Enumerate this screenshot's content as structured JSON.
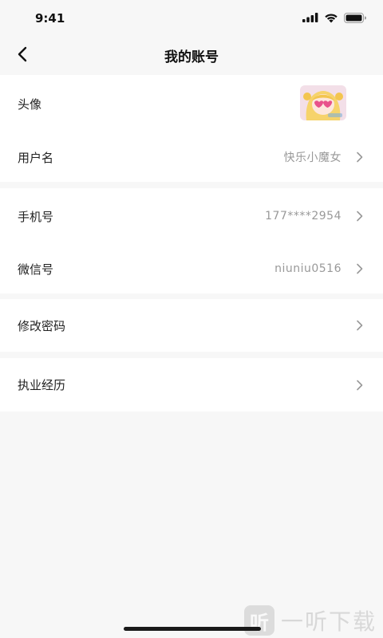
{
  "status": {
    "time": "9:41"
  },
  "header": {
    "title": "我的账号"
  },
  "profile": {
    "avatar_label": "头像",
    "username_label": "用户名",
    "username_value": "快乐小魔女"
  },
  "contact": {
    "phone_label": "手机号",
    "phone_value": "177****2954",
    "wechat_label": "微信号",
    "wechat_value": "niuniu0516"
  },
  "security": {
    "change_password_label": "修改密码"
  },
  "career": {
    "experience_label": "执业经历"
  },
  "watermark": {
    "logo_char": "听",
    "text": "一听下载"
  }
}
